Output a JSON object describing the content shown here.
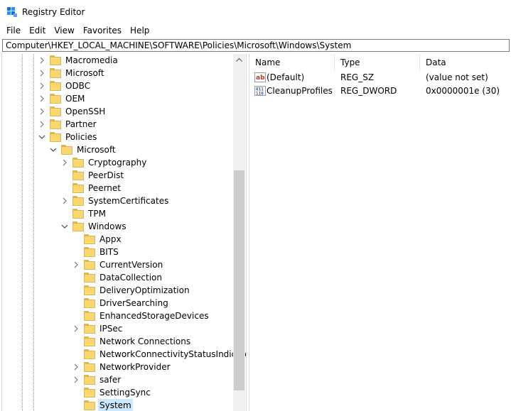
{
  "window": {
    "title": "Registry Editor",
    "icon": "regedit-icon"
  },
  "menu": [
    "File",
    "Edit",
    "View",
    "Favorites",
    "Help"
  ],
  "address": "Computer\\HKEY_LOCAL_MACHINE\\SOFTWARE\\Policies\\Microsoft\\Windows\\System",
  "tree": {
    "items": [
      {
        "label": "Macromedia",
        "expander": "collapsed"
      },
      {
        "label": "Microsoft",
        "expander": "collapsed"
      },
      {
        "label": "ODBC",
        "expander": "collapsed"
      },
      {
        "label": "OEM",
        "expander": "collapsed"
      },
      {
        "label": "OpenSSH",
        "expander": "collapsed"
      },
      {
        "label": "Partner",
        "expander": "collapsed"
      },
      {
        "label": "Policies",
        "expander": "expanded"
      },
      {
        "label": "Microsoft",
        "expander": "expanded"
      },
      {
        "label": "Cryptography",
        "expander": "collapsed"
      },
      {
        "label": "PeerDist",
        "expander": "none"
      },
      {
        "label": "Peernet",
        "expander": "none"
      },
      {
        "label": "SystemCertificates",
        "expander": "collapsed"
      },
      {
        "label": "TPM",
        "expander": "none"
      },
      {
        "label": "Windows",
        "expander": "expanded"
      },
      {
        "label": "Appx",
        "expander": "none"
      },
      {
        "label": "BITS",
        "expander": "none"
      },
      {
        "label": "CurrentVersion",
        "expander": "collapsed"
      },
      {
        "label": "DataCollection",
        "expander": "none"
      },
      {
        "label": "DeliveryOptimization",
        "expander": "none"
      },
      {
        "label": "DriverSearching",
        "expander": "none"
      },
      {
        "label": "EnhancedStorageDevices",
        "expander": "none"
      },
      {
        "label": "IPSec",
        "expander": "collapsed"
      },
      {
        "label": "Network Connections",
        "expander": "none"
      },
      {
        "label": "NetworkConnectivityStatusIndicato",
        "expander": "none"
      },
      {
        "label": "NetworkProvider",
        "expander": "collapsed"
      },
      {
        "label": "safer",
        "expander": "collapsed"
      },
      {
        "label": "SettingSync",
        "expander": "none"
      },
      {
        "label": "System",
        "expander": "none",
        "selected": true
      }
    ]
  },
  "values": {
    "columns": [
      "Name",
      "Type",
      "Data"
    ],
    "rows": [
      {
        "icon": "string-value-icon",
        "name": "(Default)",
        "type": "REG_SZ",
        "data": "(value not set)"
      },
      {
        "icon": "binary-value-icon",
        "name": "CleanupProfiles",
        "type": "REG_DWORD",
        "data": "0x0000001e (30)"
      }
    ]
  },
  "colors": {
    "selection": "#cce8ff",
    "folder": "#f8d775",
    "folder_edge": "#dcb656"
  }
}
